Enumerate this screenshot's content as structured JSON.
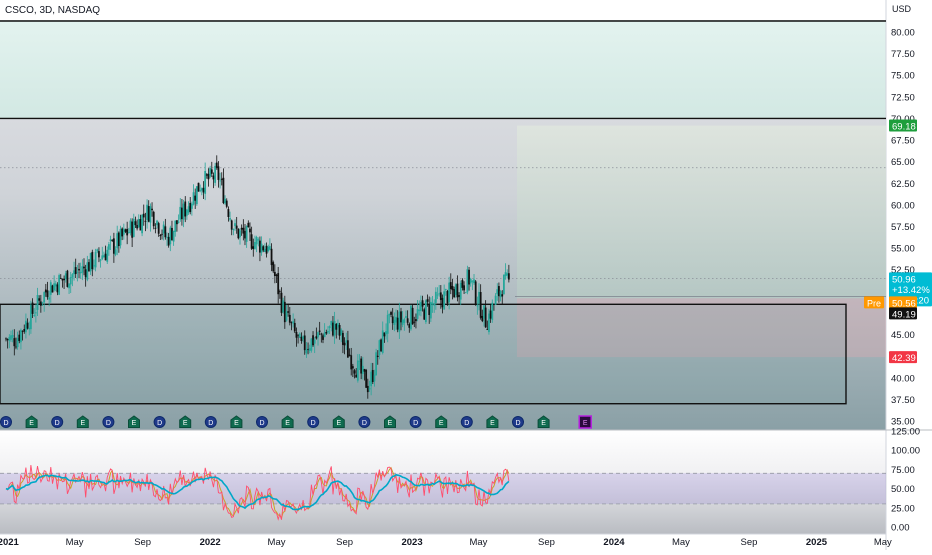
{
  "symbol_label": "CSCO, 3D, NASDAQ",
  "currency_label": "USD",
  "price_axis_ticks": [
    "80.00",
    "77.50",
    "75.00",
    "72.50",
    "70.00",
    "67.50",
    "65.00",
    "62.50",
    "60.00",
    "57.50",
    "55.00",
    "52.50",
    "50.00",
    "47.50",
    "45.00",
    "42.50",
    "40.00",
    "37.50",
    "35.00"
  ],
  "indicator_axis_ticks": [
    "125.00",
    "100.00",
    "75.00",
    "50.00",
    "25.00",
    "0.00"
  ],
  "time_axis_labels": [
    "2021",
    "May",
    "Sep",
    "2022",
    "May",
    "Sep",
    "2023",
    "May",
    "Sep",
    "2024",
    "May",
    "Sep",
    "2025",
    "May"
  ],
  "price_tags": {
    "target_value": "69.18",
    "last_value": "50.96",
    "last_change": "+13.42%",
    "last_countdown": "08:44:20",
    "pre_label": "Pre",
    "pre_value": "50.56",
    "ref_value": "49.19",
    "stop_value": "42.39"
  },
  "event_markers": [
    "D",
    "E",
    "D",
    "E",
    "D",
    "E",
    "D",
    "E",
    "D",
    "E",
    "D",
    "E",
    "D",
    "E",
    "D",
    "E",
    "D",
    "E",
    "D",
    "E",
    "D",
    "E"
  ],
  "colors": {
    "up_candle": "#26a69a",
    "down_candle": "#111111",
    "target_tag": "#1e9e3c",
    "last_tag": "#00bcd4",
    "pre_tag": "#ff9800",
    "ref_tag": "#111111",
    "stop_tag": "#f23645",
    "rsi_line": "#ff4d6d",
    "rsi_slow": "#c9a227",
    "rsi_ma": "#00a8c8"
  },
  "chart_data": {
    "type": "candlestick",
    "interval": "3D",
    "symbol": "CSCO",
    "exchange": "NASDAQ",
    "price_ylim": [
      35,
      82
    ],
    "indicator_ylim": [
      0,
      125
    ],
    "indicator_bands": [
      30,
      70
    ],
    "zones": {
      "upper_band": [
        70,
        82
      ],
      "support_box": [
        37,
        48.5
      ]
    },
    "position": {
      "entry": 49.19,
      "target": 69.18,
      "stop": 42.39
    },
    "dotted_levels": [
      64.3,
      51.5
    ],
    "key_closes": [
      {
        "date": "2021-01",
        "close": 44.5
      },
      {
        "date": "2021-03",
        "close": 50.5
      },
      {
        "date": "2021-05",
        "close": 52.5
      },
      {
        "date": "2021-07",
        "close": 55.5
      },
      {
        "date": "2021-09",
        "close": 59.5
      },
      {
        "date": "2021-10",
        "close": 56.0
      },
      {
        "date": "2021-12",
        "close": 62.5
      },
      {
        "date": "2022-01",
        "close": 63.5
      },
      {
        "date": "2022-02",
        "close": 57.0
      },
      {
        "date": "2022-04",
        "close": 55.0
      },
      {
        "date": "2022-05",
        "close": 47.5
      },
      {
        "date": "2022-06",
        "close": 43.5
      },
      {
        "date": "2022-08",
        "close": 46.0
      },
      {
        "date": "2022-09",
        "close": 42.0
      },
      {
        "date": "2022-10",
        "close": 39.0
      },
      {
        "date": "2022-11",
        "close": 46.0
      },
      {
        "date": "2023-01",
        "close": 47.5
      },
      {
        "date": "2023-03",
        "close": 50.0
      },
      {
        "date": "2023-04",
        "close": 51.5
      },
      {
        "date": "2023-05",
        "close": 46.5
      },
      {
        "date": "2023-06",
        "close": 50.96
      }
    ]
  }
}
